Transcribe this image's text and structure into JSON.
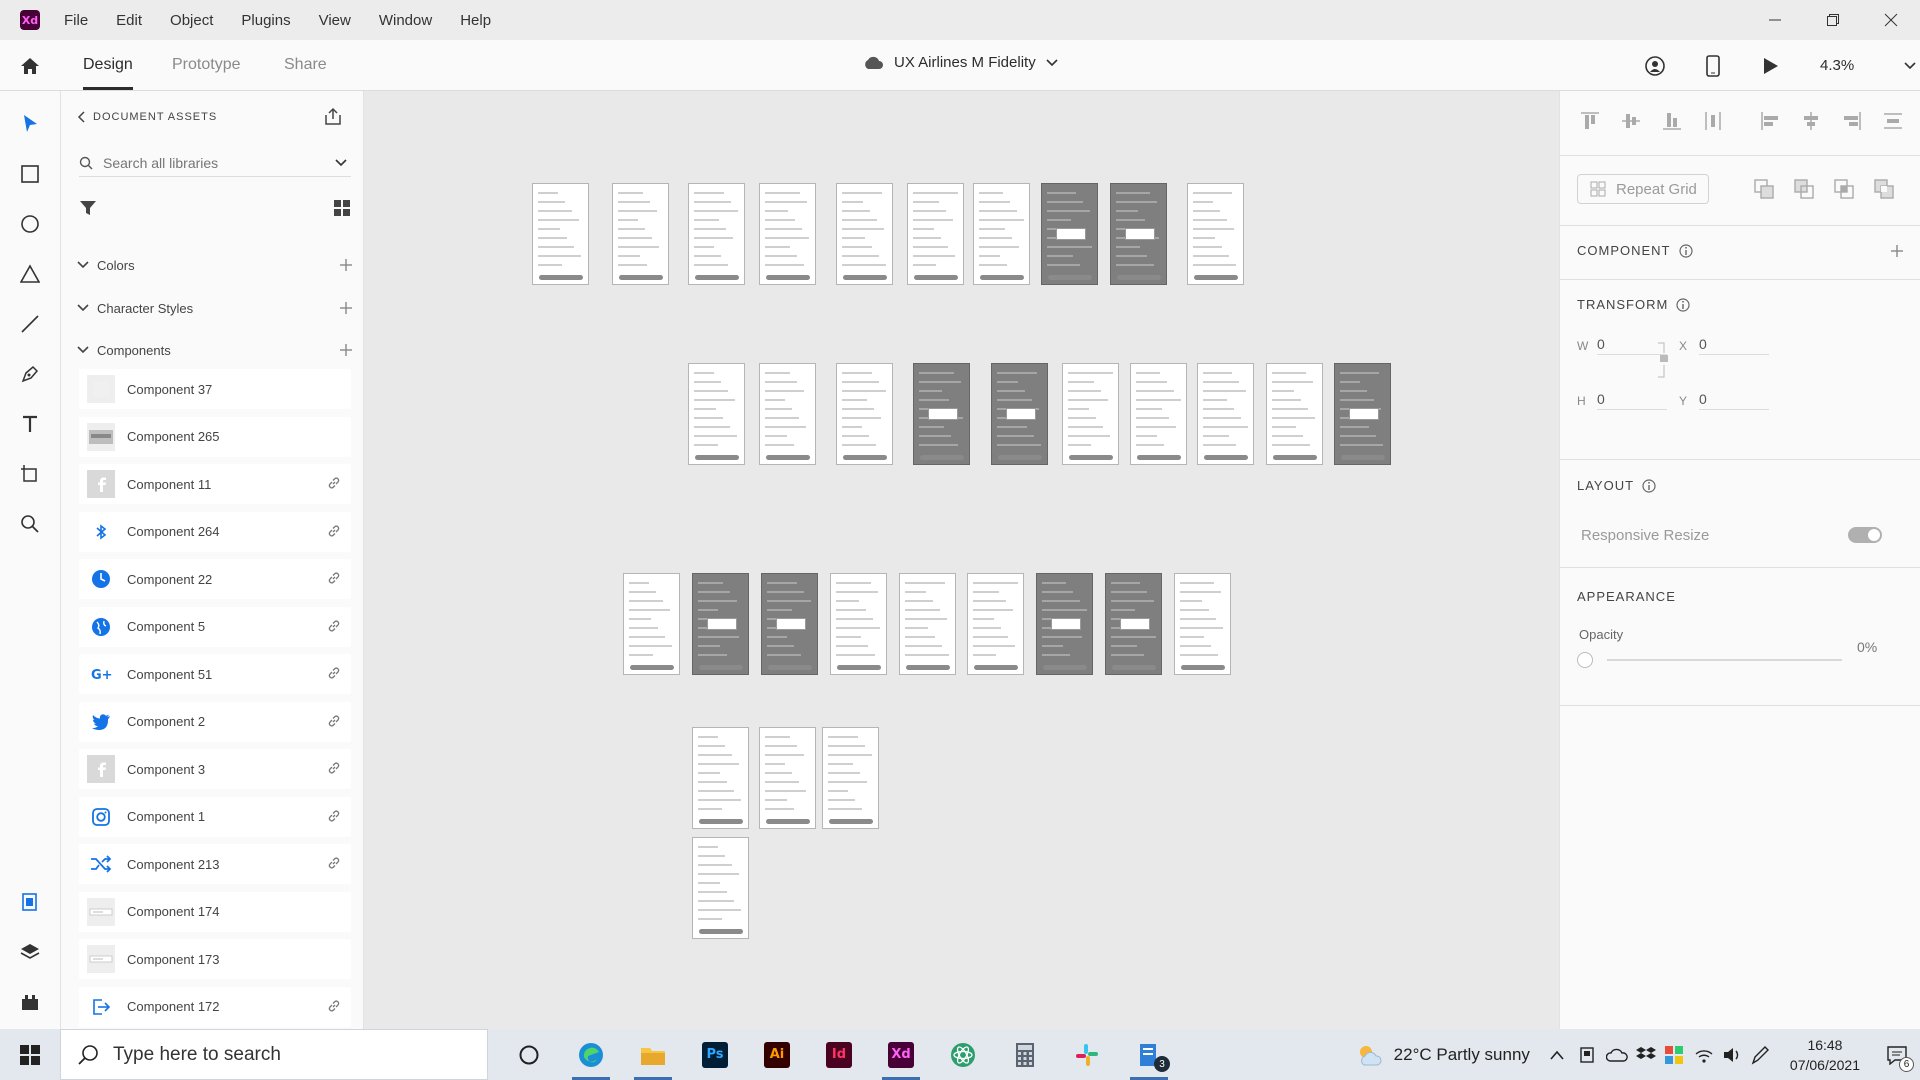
{
  "menubar": {
    "items": [
      "File",
      "Edit",
      "Object",
      "Plugins",
      "View",
      "Window",
      "Help"
    ]
  },
  "topbar": {
    "tabs": [
      "Design",
      "Prototype",
      "Share"
    ],
    "doc_title": "UX Airlines M Fidelity",
    "zoom": "4.3%"
  },
  "assets": {
    "header": "DOCUMENT ASSETS",
    "search_placeholder": "Search all libraries",
    "sections": [
      "Colors",
      "Character Styles",
      "Components"
    ],
    "components": [
      {
        "label": "Component 37",
        "icon": "blank",
        "linked": false
      },
      {
        "label": "Component 265",
        "icon": "image-thumb",
        "linked": false
      },
      {
        "label": "Component 11",
        "icon": "facebook-icon",
        "linked": true
      },
      {
        "label": "Component 264",
        "icon": "bluetooth-icon",
        "linked": true
      },
      {
        "label": "Component 22",
        "icon": "clock-icon",
        "linked": true
      },
      {
        "label": "Component 5",
        "icon": "globe-icon",
        "linked": true
      },
      {
        "label": "Component 51",
        "icon": "google-plus-icon",
        "linked": true
      },
      {
        "label": "Component 2",
        "icon": "twitter-icon",
        "linked": true
      },
      {
        "label": "Component 3",
        "icon": "facebook-icon",
        "linked": true
      },
      {
        "label": "Component 1",
        "icon": "instagram-icon",
        "linked": true
      },
      {
        "label": "Component 213",
        "icon": "shuffle-icon",
        "linked": true
      },
      {
        "label": "Component 174",
        "icon": "blank-line",
        "linked": false
      },
      {
        "label": "Component 173",
        "icon": "blank-line",
        "linked": false
      },
      {
        "label": "Component 172",
        "icon": "exit-icon",
        "linked": true
      }
    ]
  },
  "props": {
    "repeat_grid": "Repeat Grid",
    "component": "COMPONENT",
    "transform": "TRANSFORM",
    "w_label": "W",
    "w": "0",
    "h_label": "H",
    "h": "0",
    "x_label": "X",
    "x": "0",
    "y_label": "Y",
    "y": "0",
    "layout": "LAYOUT",
    "responsive_resize": "Responsive Resize",
    "appearance": "APPEARANCE",
    "opacity_label": "Opacity",
    "opacity": "0%"
  },
  "taskbar": {
    "search_placeholder": "Type here to search",
    "weather": "22°C  Partly sunny",
    "time": "16:48",
    "date": "07/06/2021",
    "notifications": "6",
    "badge": "3"
  },
  "colors": {
    "xd_brand": "#470137",
    "xd_accent": "#ff61f6",
    "icon_blue": "#1473e6"
  }
}
